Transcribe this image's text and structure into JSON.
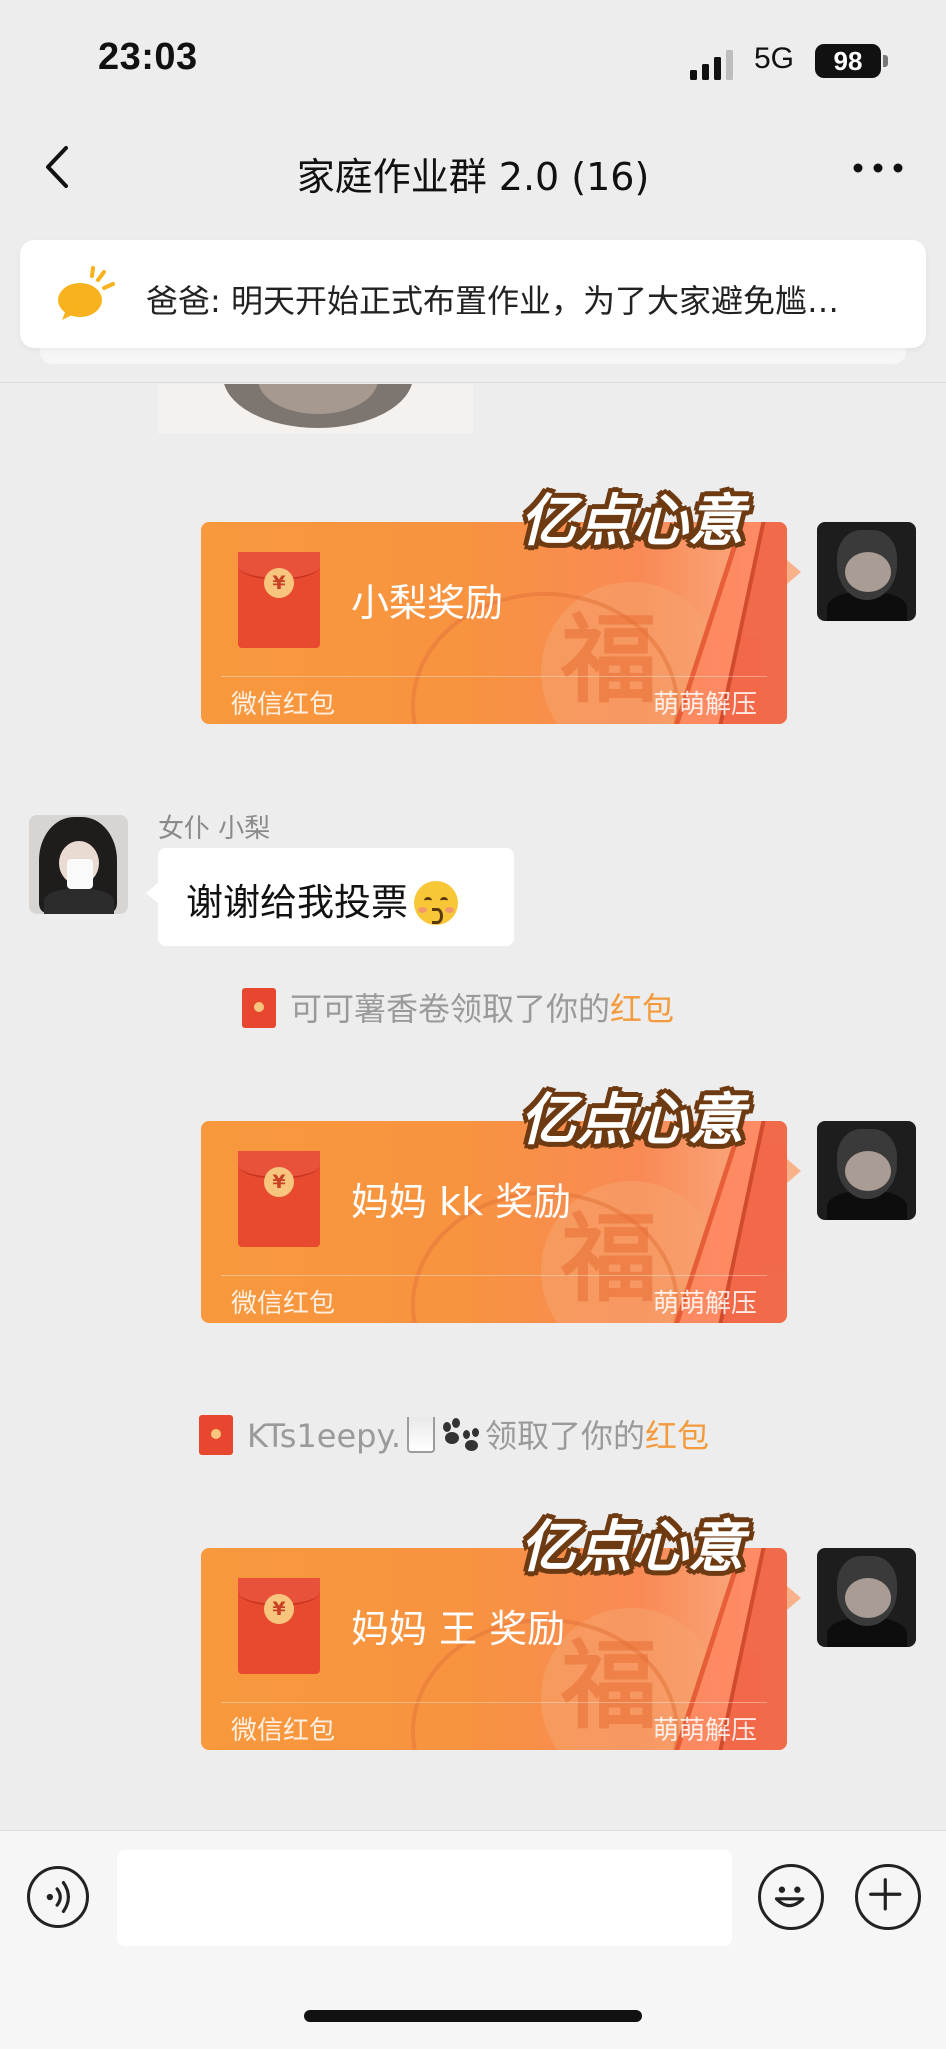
{
  "status_bar": {
    "time": "23:03",
    "network": "5G",
    "battery": "98"
  },
  "nav": {
    "title": "家庭作业群 2.0 (16)"
  },
  "pinned_notice": {
    "text": "爸爸: 明天开始正式布置作业，为了大家避免尴…"
  },
  "red_packets": [
    {
      "label": "小梨奖励",
      "title": "亿点心意",
      "footer_left": "微信红包",
      "footer_right": "萌萌解压"
    },
    {
      "label": "妈妈 kk 奖励",
      "title": "亿点心意",
      "footer_left": "微信红包",
      "footer_right": "萌萌解压"
    },
    {
      "label": "妈妈 王 奖励",
      "title": "亿点心意",
      "footer_left": "微信红包",
      "footer_right": "萌萌解压"
    }
  ],
  "message": {
    "sender": "女仆 小梨",
    "text": "谢谢给我投票"
  },
  "system_notices": [
    {
      "name": "可可薯香卷",
      "action": "领取了你的",
      "link": "红包"
    },
    {
      "name": "KTs1eepy.",
      "action": "领取了你的",
      "link": "红包"
    }
  ],
  "input": {
    "placeholder": ""
  },
  "colors": {
    "accent_orange": "#f39b3c",
    "packet_orange": "#f8993d",
    "background": "#ededed"
  }
}
